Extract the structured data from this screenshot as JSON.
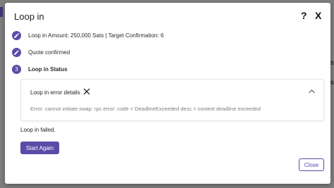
{
  "dialog": {
    "title": "Loop in",
    "help_label": "?",
    "close_label": "X"
  },
  "steps": [
    {
      "label": "Loop in Amount: 250,000 Sats | Target Confirmation: 6",
      "icon": "pencil-icon",
      "state": "completed"
    },
    {
      "label": "Quote confirmed",
      "icon": "pencil-icon",
      "state": "completed"
    },
    {
      "number": "3",
      "label": "Loop in Status",
      "state": "active"
    }
  ],
  "error_panel": {
    "title": "Loop in error details",
    "clear_icon": "close-icon",
    "toggle_icon": "chevron-up-icon",
    "message": "Error: cannot initiate swap: rpc error: code = DeadlineExceeded desc = context deadline exceeded"
  },
  "status_text": "Loop in failed.",
  "buttons": {
    "start_again": "Start Again",
    "close": "Close"
  },
  "colors": {
    "accent": "#5b4ba8",
    "backdrop": "#7f7f7f"
  }
}
